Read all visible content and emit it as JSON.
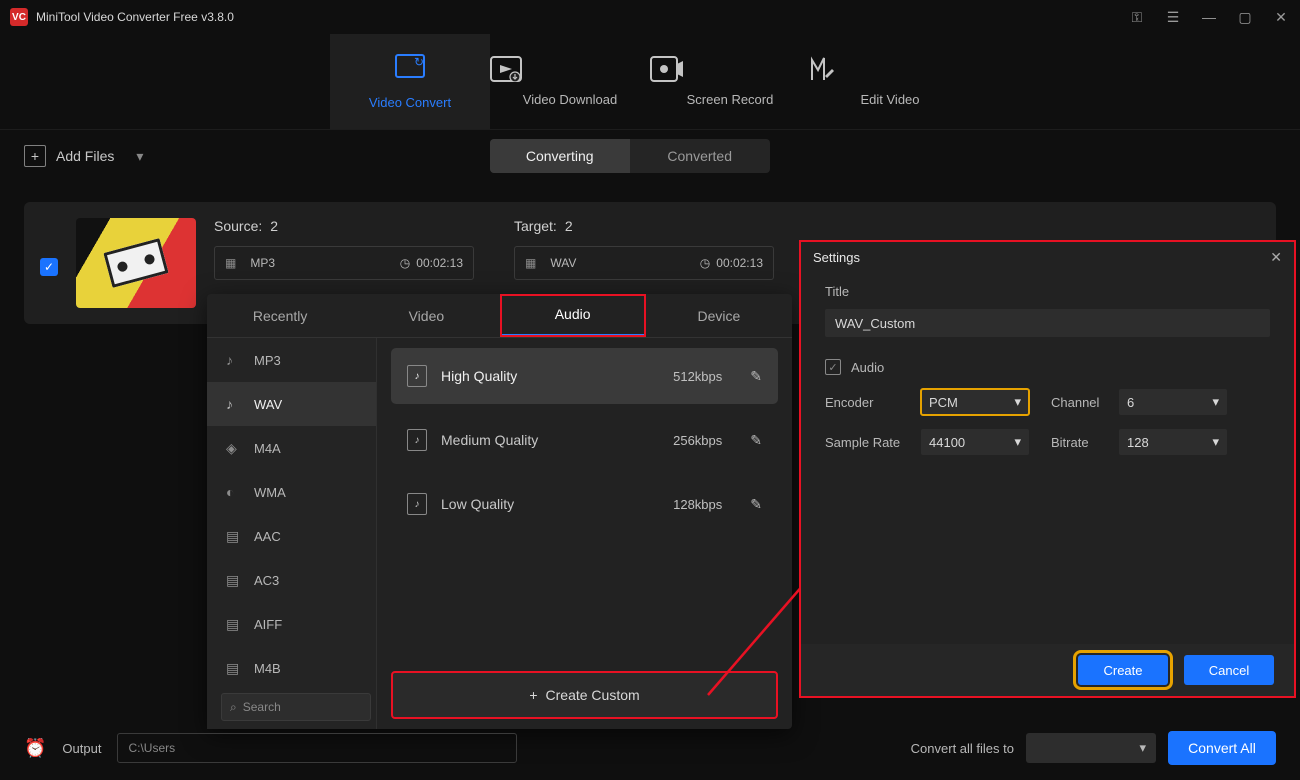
{
  "app": {
    "title": "MiniTool Video Converter Free v3.8.0",
    "logo": "VC"
  },
  "topnav": {
    "video_convert": "Video Convert",
    "video_download": "Video Download",
    "screen_record": "Screen Record",
    "edit_video": "Edit Video"
  },
  "toolbar": {
    "add_files": "Add Files"
  },
  "convert_tabs": {
    "converting": "Converting",
    "converted": "Converted"
  },
  "file": {
    "source_label": "Source:",
    "source_count": "2",
    "source_format": "MP3",
    "source_duration": "00:02:13",
    "target_label": "Target:",
    "target_count": "2",
    "target_format": "WAV",
    "target_duration": "00:02:13"
  },
  "format_panel": {
    "tabs": {
      "recently": "Recently",
      "video": "Video",
      "audio": "Audio",
      "device": "Device"
    },
    "formats": [
      "MP3",
      "WAV",
      "M4A",
      "WMA",
      "AAC",
      "AC3",
      "AIFF",
      "M4B"
    ],
    "presets": [
      {
        "name": "High Quality",
        "bitrate": "512kbps"
      },
      {
        "name": "Medium Quality",
        "bitrate": "256kbps"
      },
      {
        "name": "Low Quality",
        "bitrate": "128kbps"
      }
    ],
    "search_placeholder": "Search",
    "create_custom": "Create Custom"
  },
  "settings": {
    "title": "Settings",
    "title_label": "Title",
    "title_value": "WAV_Custom",
    "audio_label": "Audio",
    "encoder_label": "Encoder",
    "encoder_value": "PCM",
    "channel_label": "Channel",
    "channel_value": "6",
    "samplerate_label": "Sample Rate",
    "samplerate_value": "44100",
    "bitrate_label": "Bitrate",
    "bitrate_value": "128",
    "create": "Create",
    "cancel": "Cancel"
  },
  "footer": {
    "output_label": "Output",
    "output_path": "C:\\Users",
    "convert_all_to": "Convert all files to",
    "convert_all": "Convert All"
  }
}
